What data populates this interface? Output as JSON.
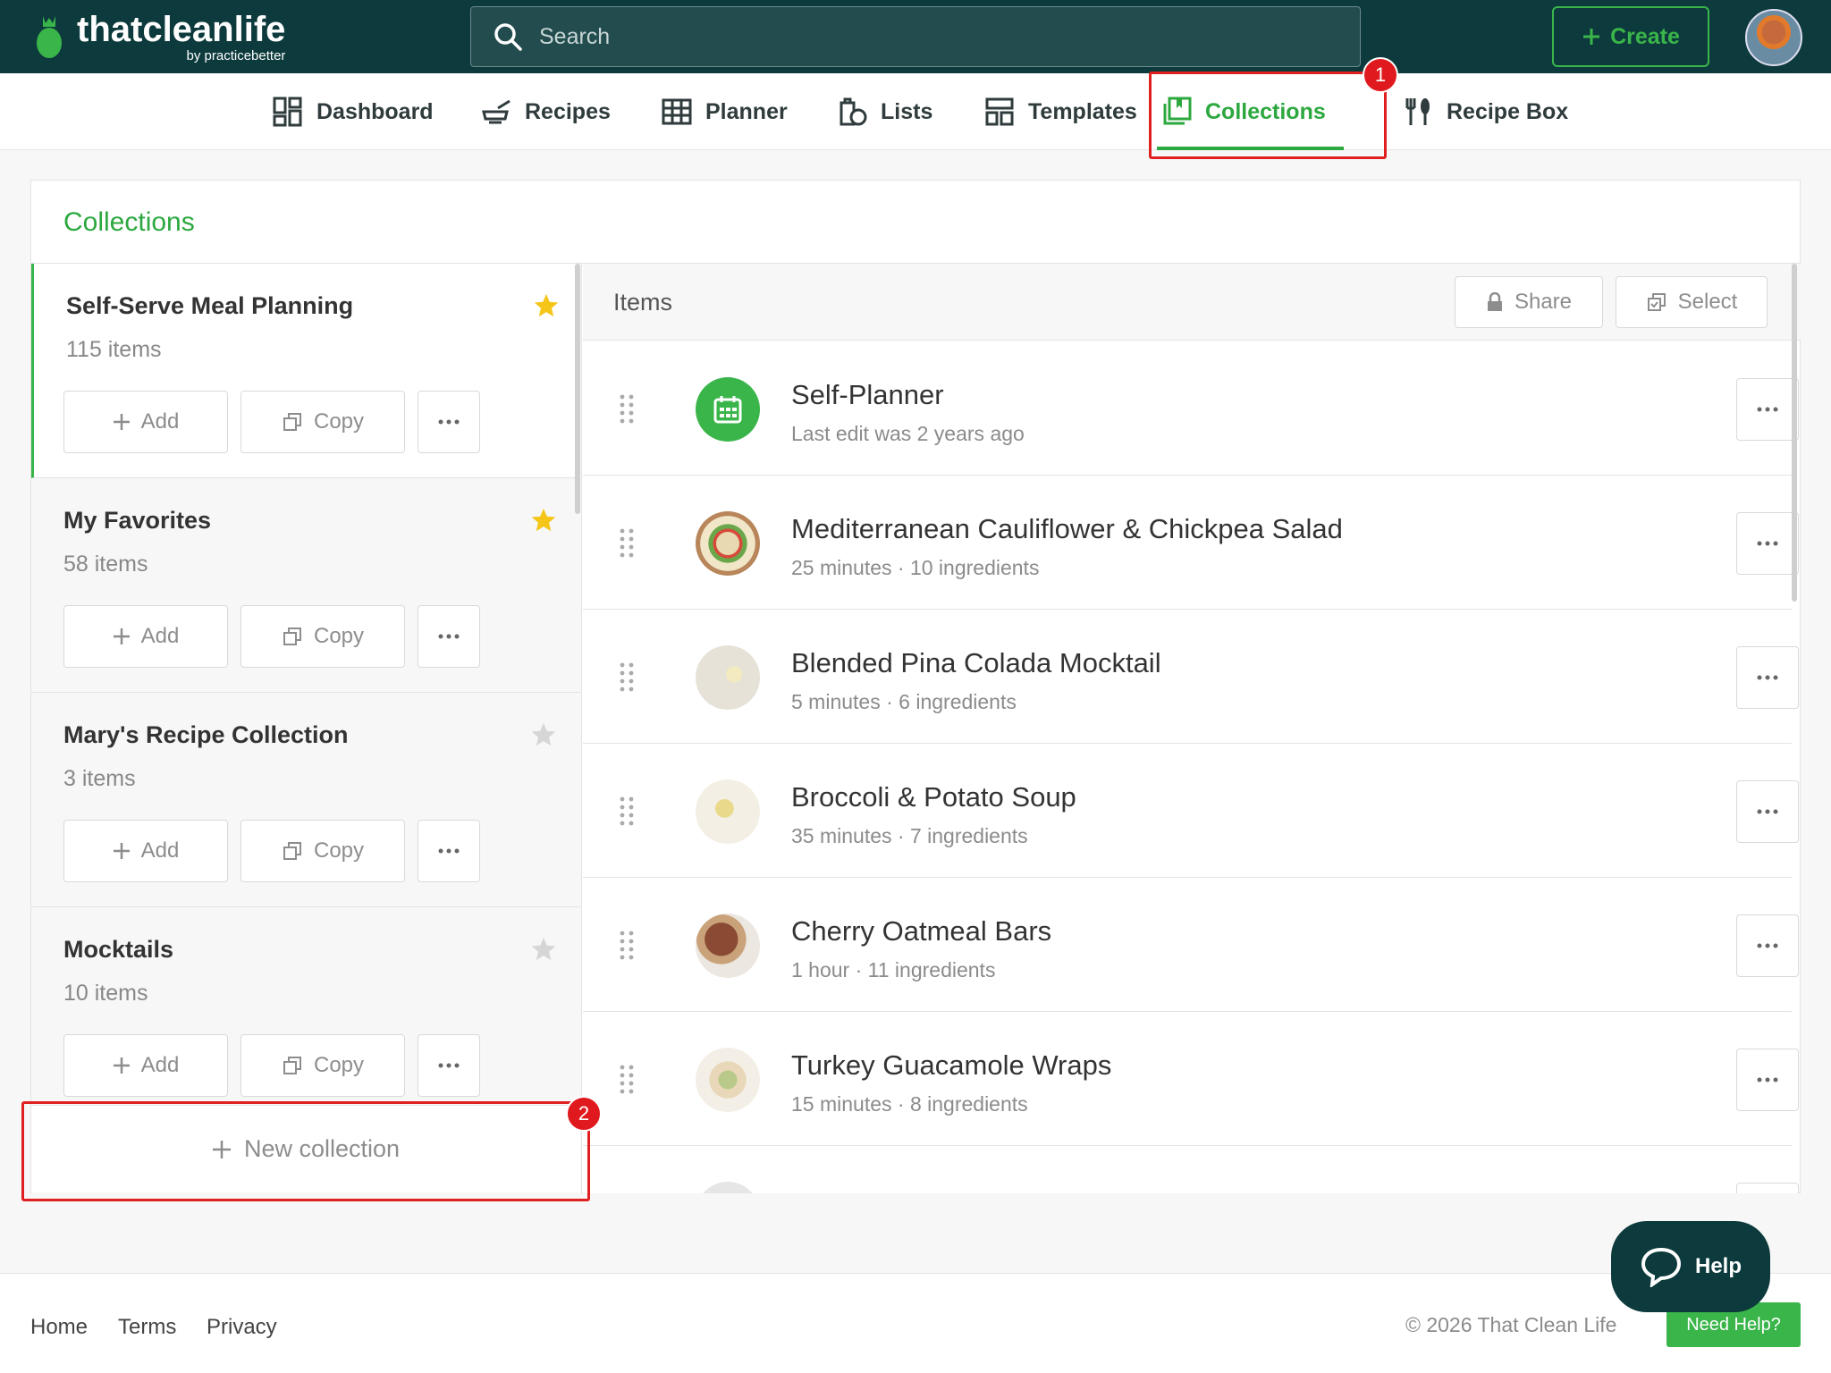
{
  "app": {
    "logo_title": "thatcleanlife",
    "logo_sub": "by practicebetter"
  },
  "search": {
    "placeholder": "Search"
  },
  "header": {
    "create_label": "Create"
  },
  "nav": {
    "items": [
      {
        "label": "Dashboard",
        "icon": "dashboard-icon"
      },
      {
        "label": "Recipes",
        "icon": "recipes-icon"
      },
      {
        "label": "Planner",
        "icon": "planner-icon"
      },
      {
        "label": "Lists",
        "icon": "lists-icon"
      },
      {
        "label": "Templates",
        "icon": "templates-icon"
      },
      {
        "label": "Collections",
        "icon": "collections-icon",
        "active": true
      },
      {
        "label": "Recipe Box",
        "icon": "recipe-box-icon"
      }
    ]
  },
  "annotations": {
    "badge1": "1",
    "badge2": "2"
  },
  "panel": {
    "title": "Collections"
  },
  "collections": [
    {
      "name": "Self-Serve Meal Planning",
      "count": "115 items",
      "starred": true,
      "selected": true
    },
    {
      "name": "My Favorites",
      "count": "58 items",
      "starred": true
    },
    {
      "name": "Mary's Recipe Collection",
      "count": "3 items",
      "starred": false
    },
    {
      "name": "Mocktails",
      "count": "10 items",
      "starred": false
    }
  ],
  "collection_buttons": {
    "add": "Add",
    "copy": "Copy"
  },
  "new_collection_label": "New collection",
  "items_header": {
    "label": "Items",
    "share": "Share",
    "select": "Select"
  },
  "items": [
    {
      "title": "Self-Planner",
      "subtitle": "Last edit was 2 years ago",
      "thumb": "planner"
    },
    {
      "title": "Mediterranean Cauliflower & Chickpea Salad",
      "subtitle": "25 minutes · 10 ingredients",
      "thumb": "salad"
    },
    {
      "title": "Blended Pina Colada Mocktail",
      "subtitle": "5 minutes · 6 ingredients",
      "thumb": "mocktail"
    },
    {
      "title": "Broccoli & Potato Soup",
      "subtitle": "35 minutes · 7 ingredients",
      "thumb": "soup"
    },
    {
      "title": "Cherry Oatmeal Bars",
      "subtitle": "1 hour · 11 ingredients",
      "thumb": "bars"
    },
    {
      "title": "Turkey Guacamole Wraps",
      "subtitle": "15 minutes · 8 ingredients",
      "thumb": "wraps"
    }
  ],
  "help": {
    "label": "Help"
  },
  "footer": {
    "links": [
      "Home",
      "Terms",
      "Privacy"
    ],
    "copyright": "© 2026 That Clean Life",
    "need_help": "Need Help?"
  },
  "colors": {
    "brand_dark": "#0d3a3c",
    "accent_green": "#3ab54a",
    "annotation_red": "#e0191e",
    "star_gold": "#f5c518"
  }
}
